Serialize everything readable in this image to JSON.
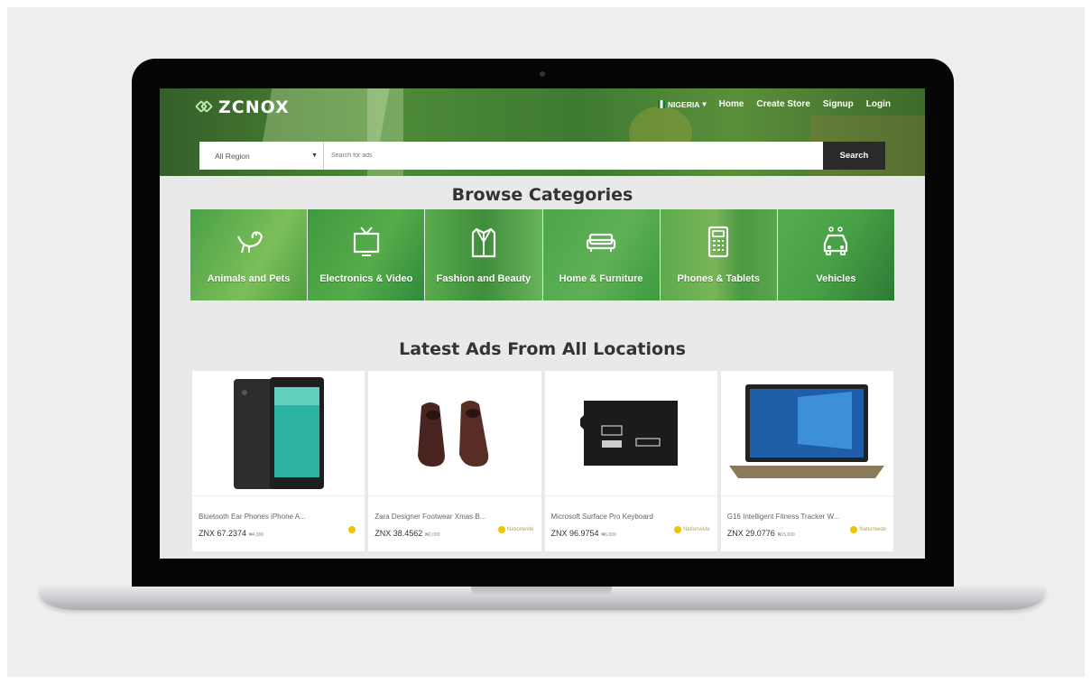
{
  "header": {
    "logo_text": "ZCNOX",
    "country": "NIGERIA",
    "nav": [
      "Home",
      "Create Store",
      "Signup",
      "Login"
    ]
  },
  "search": {
    "region": "All Region",
    "placeholder": "Search for ads",
    "button": "Search"
  },
  "browse_title": "Browse Categories",
  "categories": [
    {
      "label": "Animals and Pets",
      "icon": "bird-icon"
    },
    {
      "label": "Electronics & Video",
      "icon": "tv-icon"
    },
    {
      "label": "Fashion and Beauty",
      "icon": "shirt-icon"
    },
    {
      "label": "Home & Furniture",
      "icon": "sofa-icon"
    },
    {
      "label": "Phones & Tablets",
      "icon": "calculator-icon"
    },
    {
      "label": "Vehicles",
      "icon": "car-icon"
    }
  ],
  "latest_title": "Latest Ads From All Locations",
  "ads": [
    {
      "title": "Bluetooth Ear Phones iPhone A...",
      "price": "ZNX 67.2374",
      "old_price": "₦4,000",
      "location": ""
    },
    {
      "title": "Zara Designer Footwear Xmas B...",
      "price": "ZNX 38.4562",
      "old_price": "₦2,000",
      "location": "Nationwide"
    },
    {
      "title": "Microsoft Surface Pro Keyboard",
      "price": "ZNX 96.9754",
      "old_price": "₦6,000",
      "location": "Nationwide"
    },
    {
      "title": "G16 Intelligent Fitness Tracker W...",
      "price": "ZNX 29.0776",
      "old_price": "₦15,000",
      "location": "Nationwide"
    }
  ]
}
